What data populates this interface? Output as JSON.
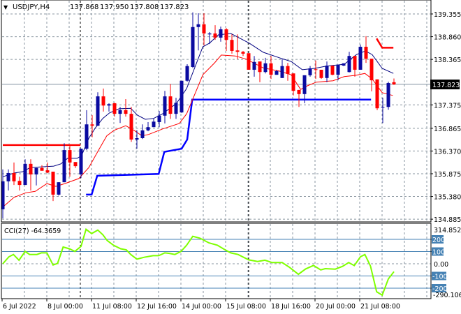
{
  "header": {
    "arrow": "▼",
    "symbol": "USDJPY,H4",
    "open": "137.868",
    "high": "137.950",
    "low": "137.808",
    "close": "137.823"
  },
  "price_axis": {
    "ticks": [
      "139.355",
      "138.860",
      "138.365",
      "137.375",
      "136.865",
      "136.370",
      "135.875",
      "135.380",
      "134.885"
    ],
    "current": "137.823"
  },
  "cci": {
    "label": "CCI(27) -64.3659",
    "max_label": "314.8526",
    "min_label": "-290.1064",
    "zero_label": "0.00",
    "levels": [
      "200",
      "100",
      "-100",
      "-200"
    ]
  },
  "time_axis": [
    "6 Jul 2022",
    "8 Jul 00:00",
    "11 Jul 08:00",
    "12 Jul 16:00",
    "14 Jul 00:00",
    "15 Jul 08:00",
    "18 Jul 16:00",
    "20 Jul 00:00",
    "21 Jul 08:00"
  ],
  "colors": {
    "bull": "#0a0aa0",
    "bear": "#ff0000",
    "ma_fast": "#000080",
    "ma_slow": "#ff0000",
    "support": "#0000ff",
    "resistance": "#ff0000",
    "cci": "#7fff00",
    "level": "#4682b4"
  },
  "chart_data": {
    "type": "candlestick",
    "title": "USDJPY,H4",
    "ylim": [
      134.885,
      139.355
    ],
    "candles_ohlc": [
      [
        135.1,
        135.97,
        134.9,
        135.71
      ],
      [
        135.71,
        135.97,
        135.51,
        135.89
      ],
      [
        135.89,
        136.12,
        135.63,
        135.71
      ],
      [
        135.72,
        135.81,
        135.51,
        135.63
      ],
      [
        135.63,
        136.19,
        135.63,
        136.09
      ],
      [
        136.09,
        136.19,
        135.51,
        135.86
      ],
      [
        135.86,
        136.0,
        135.62,
        136.0
      ],
      [
        136.0,
        136.06,
        135.94,
        135.94
      ],
      [
        135.95,
        136.12,
        135.89,
        135.9
      ],
      [
        135.92,
        135.92,
        135.28,
        135.42
      ],
      [
        135.42,
        135.69,
        135.4,
        135.69
      ],
      [
        135.69,
        136.54,
        135.69,
        136.39
      ],
      [
        136.39,
        136.5,
        135.81,
        136.12
      ],
      [
        136.13,
        136.13,
        136.0,
        136.04
      ],
      [
        135.86,
        136.42,
        135.78,
        136.42
      ],
      [
        136.42,
        137.26,
        136.39,
        136.95
      ],
      [
        136.95,
        137.15,
        136.67,
        136.92
      ],
      [
        136.92,
        137.65,
        136.92,
        137.56
      ],
      [
        137.56,
        137.73,
        137.23,
        137.36
      ],
      [
        137.36,
        137.41,
        137.23,
        137.39
      ],
      [
        137.41,
        137.42,
        137.12,
        137.18
      ],
      [
        137.18,
        137.33,
        136.98,
        137.26
      ],
      [
        137.26,
        137.5,
        137.12,
        137.18
      ],
      [
        137.18,
        137.33,
        136.57,
        136.62
      ],
      [
        136.62,
        136.82,
        136.42,
        136.65
      ],
      [
        136.65,
        136.95,
        136.63,
        136.82
      ],
      [
        136.82,
        137.0,
        136.8,
        136.89
      ],
      [
        136.89,
        137.08,
        136.89,
        137.01
      ],
      [
        137.0,
        137.24,
        136.89,
        137.14
      ],
      [
        137.14,
        137.68,
        136.97,
        137.56
      ],
      [
        137.56,
        137.83,
        137.07,
        137.18
      ],
      [
        137.18,
        137.53,
        137.07,
        137.42
      ],
      [
        137.21,
        137.9,
        137.2,
        137.9
      ],
      [
        137.9,
        138.26,
        137.88,
        138.22
      ],
      [
        138.2,
        139.39,
        138.18,
        139.07
      ],
      [
        139.07,
        139.37,
        138.56,
        139.13
      ],
      [
        139.13,
        139.37,
        138.67,
        138.93
      ],
      [
        138.91,
        138.96,
        138.7,
        138.93
      ],
      [
        138.93,
        139.11,
        138.79,
        138.84
      ],
      [
        138.84,
        139.08,
        138.75,
        139.02
      ],
      [
        139.02,
        139.05,
        138.55,
        138.79
      ],
      [
        138.79,
        138.91,
        138.49,
        138.55
      ],
      [
        138.56,
        138.91,
        138.37,
        138.53
      ],
      [
        138.53,
        138.55,
        138.44,
        138.49
      ],
      [
        138.5,
        138.5,
        138.14,
        138.14
      ],
      [
        138.14,
        138.44,
        137.99,
        138.31
      ],
      [
        138.32,
        138.32,
        137.87,
        138.09
      ],
      [
        138.09,
        138.4,
        138.06,
        138.28
      ],
      [
        138.28,
        138.44,
        137.94,
        138.03
      ],
      [
        138.03,
        138.14,
        138.03,
        138.11
      ],
      [
        137.96,
        138.37,
        137.96,
        138.22
      ],
      [
        138.22,
        138.29,
        137.9,
        138.05
      ],
      [
        138.06,
        138.06,
        137.58,
        137.68
      ],
      [
        137.7,
        137.7,
        137.33,
        137.61
      ],
      [
        137.61,
        138.02,
        137.41,
        138.02
      ],
      [
        138.02,
        138.22,
        137.99,
        138.17
      ],
      [
        138.15,
        138.34,
        137.94,
        138.14
      ],
      [
        138.14,
        138.14,
        137.94,
        137.96
      ],
      [
        137.96,
        138.32,
        137.87,
        138.23
      ],
      [
        138.23,
        138.23,
        138.02,
        138.03
      ],
      [
        138.03,
        138.25,
        137.91,
        138.25
      ],
      [
        138.23,
        138.28,
        138.22,
        138.28
      ],
      [
        138.09,
        138.53,
        138.08,
        138.44
      ],
      [
        138.44,
        138.44,
        137.99,
        138.14
      ],
      [
        138.14,
        138.69,
        138.14,
        138.64
      ],
      [
        138.64,
        138.87,
        138.29,
        138.38
      ],
      [
        138.38,
        138.38,
        137.67,
        137.91
      ],
      [
        137.93,
        137.93,
        137.26,
        137.3
      ],
      [
        137.32,
        137.53,
        136.98,
        137.33
      ],
      [
        137.33,
        137.88,
        137.27,
        137.85
      ],
      [
        137.868,
        137.95,
        137.808,
        137.823
      ]
    ],
    "ma_fast": [
      [
        0,
        135.81
      ],
      [
        2,
        135.89
      ],
      [
        3.6,
        135.92
      ],
      [
        4.9,
        136.01
      ],
      [
        9.1,
        136.04
      ],
      [
        10.4,
        136.09
      ],
      [
        11.6,
        136.21
      ],
      [
        13.3,
        136.21
      ],
      [
        14.1,
        136.27
      ],
      [
        15.4,
        136.65
      ],
      [
        16.6,
        136.88
      ],
      [
        17.9,
        137.08
      ],
      [
        19.1,
        137.2
      ],
      [
        20.8,
        137.29
      ],
      [
        22.9,
        137.3
      ],
      [
        24.1,
        137.15
      ],
      [
        25.5,
        137.06
      ],
      [
        27,
        137.08
      ],
      [
        28.6,
        137.18
      ],
      [
        31.1,
        137.41
      ],
      [
        32.9,
        137.73
      ],
      [
        35.8,
        138.64
      ],
      [
        37,
        138.72
      ],
      [
        38.6,
        138.9
      ],
      [
        40.8,
        138.93
      ],
      [
        44.1,
        138.72
      ],
      [
        46.6,
        138.52
      ],
      [
        49.5,
        138.4
      ],
      [
        51.6,
        138.32
      ],
      [
        53.6,
        138.14
      ],
      [
        55.8,
        138.17
      ],
      [
        57.9,
        138.22
      ],
      [
        61.1,
        138.26
      ],
      [
        63.3,
        138.47
      ],
      [
        64.9,
        138.55
      ],
      [
        66.1,
        138.47
      ],
      [
        67.9,
        138.17
      ],
      [
        69.9,
        138.06
      ]
    ],
    "ma_slow": [
      [
        0,
        135.15
      ],
      [
        2,
        135.36
      ],
      [
        4.1,
        135.46
      ],
      [
        5.8,
        135.49
      ],
      [
        7.9,
        135.66
      ],
      [
        9.5,
        135.6
      ],
      [
        11.1,
        135.66
      ],
      [
        13.6,
        135.77
      ],
      [
        15.4,
        136.01
      ],
      [
        17,
        136.36
      ],
      [
        18.6,
        136.7
      ],
      [
        19.9,
        136.82
      ],
      [
        22,
        136.92
      ],
      [
        23.5,
        136.82
      ],
      [
        24.9,
        136.7
      ],
      [
        26.1,
        136.73
      ],
      [
        28.6,
        136.85
      ],
      [
        31.6,
        136.97
      ],
      [
        32.9,
        137.18
      ],
      [
        34.1,
        137.53
      ],
      [
        35.8,
        138.03
      ],
      [
        37.9,
        138.29
      ],
      [
        39.1,
        138.46
      ],
      [
        41.6,
        138.44
      ],
      [
        43.6,
        138.37
      ],
      [
        46.6,
        138.18
      ],
      [
        49.5,
        138.11
      ],
      [
        51.6,
        138.03
      ],
      [
        53.3,
        137.71
      ],
      [
        54.5,
        137.79
      ],
      [
        56.1,
        137.87
      ],
      [
        59.1,
        137.9
      ],
      [
        61.1,
        137.99
      ],
      [
        63.3,
        138.02
      ],
      [
        64.8,
        138.06
      ],
      [
        66.1,
        137.94
      ],
      [
        67.9,
        137.64
      ],
      [
        69.8,
        137.58
      ]
    ],
    "support_line": [
      [
        14.9,
        135.42
      ],
      [
        15.9,
        135.42
      ],
      [
        16.9,
        135.83
      ],
      [
        27.9,
        135.87
      ],
      [
        28.9,
        136.35
      ],
      [
        32,
        136.42
      ],
      [
        33,
        136.62
      ],
      [
        33.9,
        137.49
      ],
      [
        65.9,
        137.49
      ]
    ],
    "resistance_left": [
      [
        0,
        136.5
      ],
      [
        13.9,
        136.5
      ]
    ],
    "resistance_right": [
      [
        66.9,
        138.82
      ],
      [
        67.9,
        138.62
      ],
      [
        69.9,
        138.62
      ]
    ],
    "cci_series": [
      [
        0,
        0
      ],
      [
        1.1,
        57
      ],
      [
        1.9,
        76
      ],
      [
        2.9,
        29
      ],
      [
        4,
        101
      ],
      [
        4.8,
        76
      ],
      [
        6.1,
        76
      ],
      [
        6.9,
        89
      ],
      [
        7.9,
        89
      ],
      [
        9,
        -10
      ],
      [
        9.8,
        3
      ],
      [
        10.8,
        137
      ],
      [
        11.9,
        123
      ],
      [
        12.9,
        101
      ],
      [
        14,
        143
      ],
      [
        14.9,
        282
      ],
      [
        15.9,
        247
      ],
      [
        17,
        276
      ],
      [
        17.9,
        238
      ],
      [
        18.7,
        190
      ],
      [
        19.8,
        152
      ],
      [
        21.1,
        123
      ],
      [
        22.1,
        114
      ],
      [
        22.9,
        76
      ],
      [
        24,
        38
      ],
      [
        25.3,
        53
      ],
      [
        26.9,
        66
      ],
      [
        27.9,
        66
      ],
      [
        29,
        89
      ],
      [
        29.8,
        85
      ],
      [
        30.8,
        76
      ],
      [
        31.9,
        101
      ],
      [
        32.9,
        152
      ],
      [
        34,
        225
      ],
      [
        35.3,
        209
      ],
      [
        36.9,
        171
      ],
      [
        38.4,
        152
      ],
      [
        39.8,
        114
      ],
      [
        40.8,
        89
      ],
      [
        42.1,
        76
      ],
      [
        44,
        32
      ],
      [
        45.6,
        19
      ],
      [
        46.9,
        29
      ],
      [
        48.2,
        10
      ],
      [
        50,
        10
      ],
      [
        51.3,
        -29
      ],
      [
        52.9,
        -86
      ],
      [
        54.2,
        -42
      ],
      [
        55.6,
        -14
      ],
      [
        56.9,
        -50
      ],
      [
        57.7,
        -40
      ],
      [
        59.5,
        -44
      ],
      [
        60.8,
        -21
      ],
      [
        61.9,
        10
      ],
      [
        62.9,
        -15
      ],
      [
        64,
        57
      ],
      [
        64.8,
        76
      ],
      [
        65.8,
        -19
      ],
      [
        66.9,
        -229
      ],
      [
        67.9,
        -257
      ],
      [
        69,
        -124
      ],
      [
        70,
        -64.37
      ]
    ],
    "cci_ylim": [
      -290.1064,
      314.8526
    ]
  }
}
